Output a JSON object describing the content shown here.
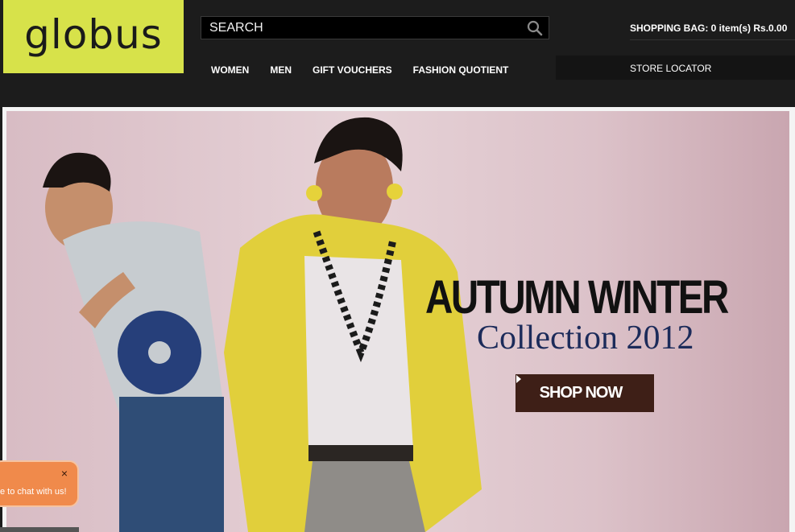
{
  "brand": {
    "logo_text": "globus",
    "logo_color": "#d7e24a"
  },
  "search": {
    "placeholder": "SEARCH"
  },
  "header": {
    "bag_text": "SHOPPING BAG: 0 item(s) Rs.0.00",
    "store_locator": "STORE LOCATOR"
  },
  "nav": {
    "items": [
      "WOMEN",
      "MEN",
      "GIFT VOUCHERS",
      "FASHION QUOTIENT"
    ]
  },
  "banner": {
    "headline": "AUTUMN WINTER",
    "subline": "Collection 2012",
    "cta": "SHOP NOW",
    "cta_color": "#3e1f17"
  },
  "chat": {
    "message": "e to chat with us!",
    "close_glyph": "×"
  },
  "icons": {
    "search": "search-icon",
    "cta_arrow": "chevron-right-icon",
    "close": "close-icon"
  }
}
